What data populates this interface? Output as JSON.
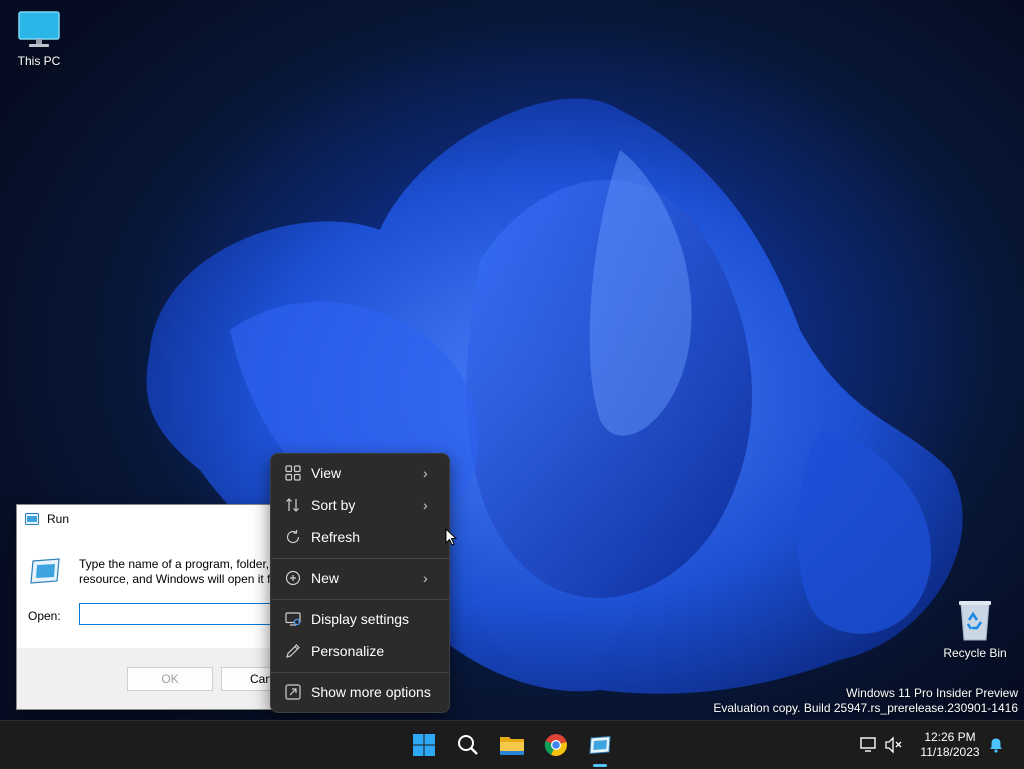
{
  "desktop": {
    "icons": [
      {
        "label": "This PC",
        "icon": "monitor-icon"
      },
      {
        "label": "Recycle Bin",
        "icon": "recycle-bin-icon"
      }
    ]
  },
  "run_dialog": {
    "title": "Run",
    "description_line1": "Type the name of a program, folder,",
    "description_line2": "resource, and Windows will open it f",
    "open_label": "Open:",
    "open_value": "",
    "ok_label": "OK",
    "cancel_label": "Canc"
  },
  "context_menu": {
    "items": [
      {
        "label": "View",
        "icon": "grid-icon",
        "submenu": true
      },
      {
        "label": "Sort by",
        "icon": "sort-icon",
        "submenu": true
      },
      {
        "label": "Refresh",
        "icon": "refresh-icon",
        "submenu": false
      },
      {
        "label": "New",
        "icon": "plus-circle-icon",
        "submenu": true
      },
      {
        "label": "Display settings",
        "icon": "display-icon",
        "submenu": false
      },
      {
        "label": "Personalize",
        "icon": "pen-icon",
        "submenu": false
      },
      {
        "label": "Show more options",
        "icon": "expand-icon",
        "submenu": false
      }
    ],
    "submenu_glyph": "›"
  },
  "watermark": {
    "line1": "Windows 11 Pro Insider Preview",
    "line2": "Evaluation copy. Build 25947.rs_prerelease.230901-1416"
  },
  "taskbar": {
    "apps": [
      "start-icon",
      "search-icon",
      "file-explorer-icon",
      "chrome-icon",
      "run-icon"
    ],
    "time": "12:26 PM",
    "date": "11/18/2023"
  },
  "colors": {
    "accent": "#0078d4",
    "menu_bg": "#2b2b2b",
    "taskbar_bg": "#1c1c1c"
  }
}
